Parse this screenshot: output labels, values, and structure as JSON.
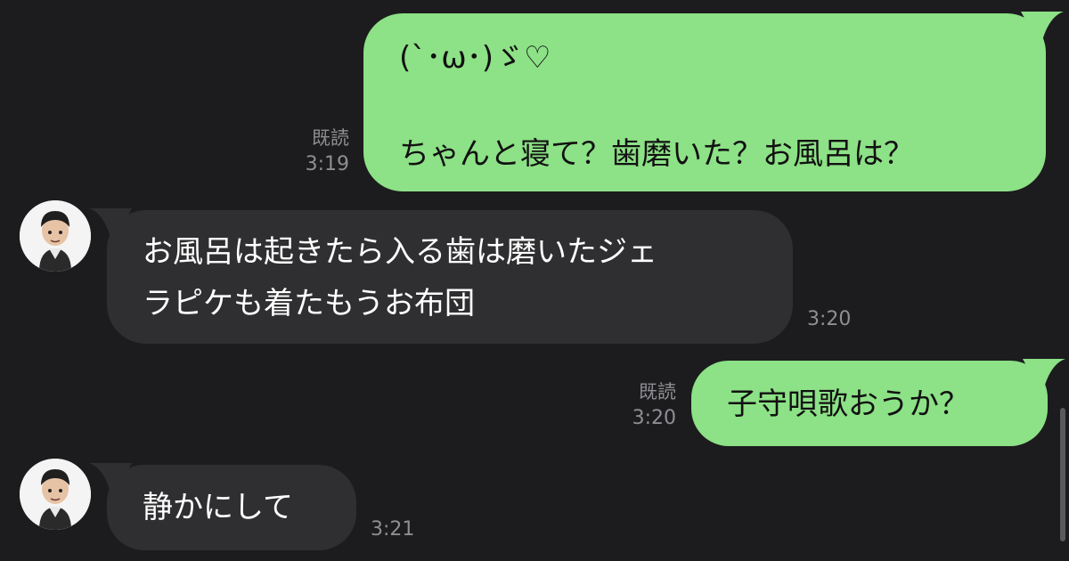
{
  "messages": [
    {
      "id": "m1",
      "direction": "outgoing",
      "lines": [
        "(`･ω･)ゞ♡",
        "",
        "ちゃんと寝て？歯磨いた？お風呂は？"
      ],
      "read_label": "既読",
      "time": "3:19"
    },
    {
      "id": "m2",
      "direction": "incoming",
      "lines": [
        "お風呂は起きたら入る歯は磨いたジェ",
        "ラピケも着たもうお布団"
      ],
      "time": "3:20"
    },
    {
      "id": "m3",
      "direction": "outgoing",
      "lines": [
        "子守唄歌おうか？"
      ],
      "read_label": "既読",
      "time": "3:20"
    },
    {
      "id": "m4",
      "direction": "incoming",
      "lines": [
        "静かにして"
      ],
      "time": "3:21"
    }
  ],
  "colors": {
    "background": "#1c1c1e",
    "outgoing_bubble": "#8de186",
    "incoming_bubble": "#2f2f31",
    "meta_text": "#8e8e93"
  },
  "icons": {
    "avatar": "chibi-character-avatar-icon"
  }
}
